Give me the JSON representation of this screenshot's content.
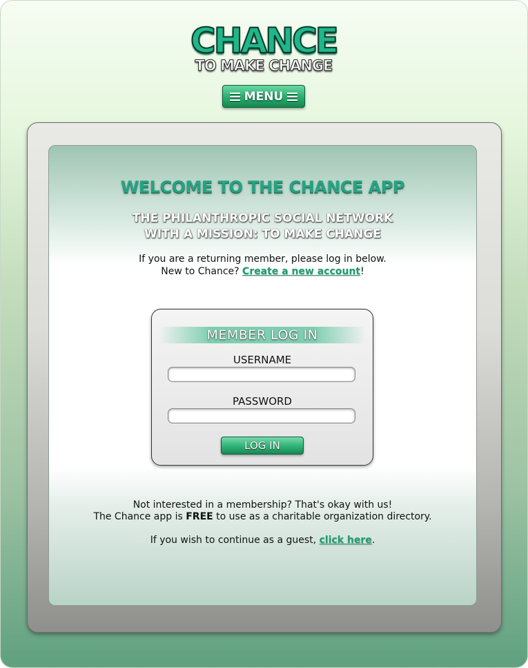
{
  "logo": {
    "top_text": "CHANCE",
    "bottom_text": "TO MAKE CHANGE"
  },
  "menu": {
    "label": "MENU",
    "icon": "hamburger-icon"
  },
  "welcome": {
    "title": "WELCOME TO THE CHANCE APP",
    "subtitle_line1": "THE PHILANTHROPIC SOCIAL NETWORK",
    "subtitle_line2": "WITH A MISSION: TO MAKE CHANGE",
    "intro_line1": "If you are a returning member, please log in below.",
    "intro_line2_prefix": "New to Chance? ",
    "create_account_link": "Create a new account",
    "intro_line2_suffix": "!"
  },
  "login": {
    "header": "MEMBER LOG IN",
    "username_label": "USERNAME",
    "username_value": "",
    "password_label": "PASSWORD",
    "password_value": "",
    "button_label": "LOG IN"
  },
  "footer": {
    "line1": "Not interested in a membership? That's okay with us!",
    "line2_prefix": "The Chance app is ",
    "line2_bold": "FREE",
    "line2_suffix": " to use as a charitable organization directory.",
    "guest_prefix": "If you wish to continue as a guest, ",
    "guest_link": "click here",
    "guest_suffix": "."
  },
  "colors": {
    "accent_green": "#25a382",
    "button_green": "#2eb073",
    "link_green": "#1f9b73"
  }
}
